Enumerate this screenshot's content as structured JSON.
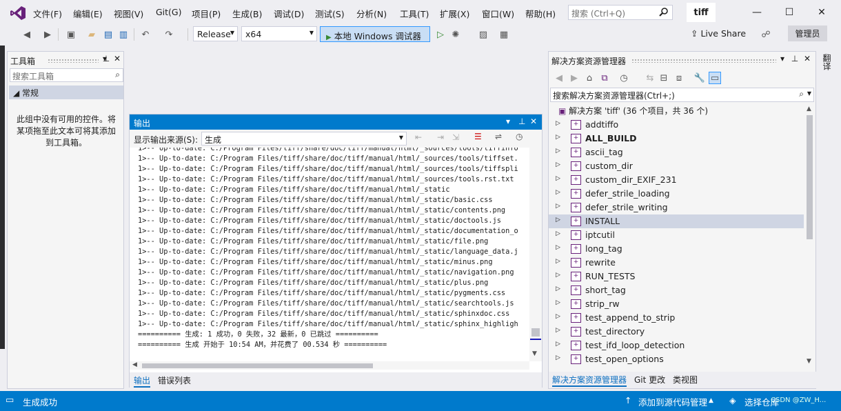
{
  "menu": [
    "文件(F)",
    "编辑(E)",
    "视图(V)",
    "Git(G)",
    "项目(P)",
    "生成(B)",
    "调试(D)",
    "测试(S)",
    "分析(N)",
    "工具(T)",
    "扩展(X)",
    "窗口(W)",
    "帮助(H)"
  ],
  "search": {
    "placeholder": "搜索 (Ctrl+Q)"
  },
  "project_title": "tiff",
  "toolbar": {
    "config": "Release",
    "platform": "x64",
    "run_label": "本地 Windows 调试器",
    "live_share": "Live Share",
    "admin": "管理员"
  },
  "toolbox": {
    "title": "工具箱",
    "search_placeholder": "搜索工具箱",
    "group": "常规",
    "empty_text": "此组中没有可用的控件。将某项拖至此文本可将其添加到工具箱。"
  },
  "output": {
    "title": "输出",
    "source_label": "显示输出来源(S):",
    "source_value": "生成",
    "lines": [
      "1>-- Up-to-date: C:/Program Files/tiff/share/doc/tiff/manual/html/_sources/tools/tiffinfo",
      "1>-- Up-to-date: C:/Program Files/tiff/share/doc/tiff/manual/html/_sources/tools/tiffset.",
      "1>-- Up-to-date: C:/Program Files/tiff/share/doc/tiff/manual/html/_sources/tools/tiffspli",
      "1>-- Up-to-date: C:/Program Files/tiff/share/doc/tiff/manual/html/_sources/tools.rst.txt",
      "1>-- Up-to-date: C:/Program Files/tiff/share/doc/tiff/manual/html/_static",
      "1>-- Up-to-date: C:/Program Files/tiff/share/doc/tiff/manual/html/_static/basic.css",
      "1>-- Up-to-date: C:/Program Files/tiff/share/doc/tiff/manual/html/_static/contents.png",
      "1>-- Up-to-date: C:/Program Files/tiff/share/doc/tiff/manual/html/_static/doctools.js",
      "1>-- Up-to-date: C:/Program Files/tiff/share/doc/tiff/manual/html/_static/documentation_o",
      "1>-- Up-to-date: C:/Program Files/tiff/share/doc/tiff/manual/html/_static/file.png",
      "1>-- Up-to-date: C:/Program Files/tiff/share/doc/tiff/manual/html/_static/language_data.j",
      "1>-- Up-to-date: C:/Program Files/tiff/share/doc/tiff/manual/html/_static/minus.png",
      "1>-- Up-to-date: C:/Program Files/tiff/share/doc/tiff/manual/html/_static/navigation.png",
      "1>-- Up-to-date: C:/Program Files/tiff/share/doc/tiff/manual/html/_static/plus.png",
      "1>-- Up-to-date: C:/Program Files/tiff/share/doc/tiff/manual/html/_static/pygments.css",
      "1>-- Up-to-date: C:/Program Files/tiff/share/doc/tiff/manual/html/_static/searchtools.js",
      "1>-- Up-to-date: C:/Program Files/tiff/share/doc/tiff/manual/html/_static/sphinxdoc.css",
      "1>-- Up-to-date: C:/Program Files/tiff/share/doc/tiff/manual/html/_static/sphinx_highligh",
      "========== 生成: 1 成功，0 失败，32 最新，0 已跳过 ==========",
      "========== 生成 开始于 10:54 AM，并花费了 00.534 秒 =========="
    ],
    "tabs": [
      "输出",
      "错误列表"
    ]
  },
  "solution": {
    "title": "解决方案资源管理器",
    "search_placeholder": "搜索解决方案资源管理器(Ctrl+;)",
    "root": "解决方案 'tiff' (36 个项目，共 36 个)",
    "items": [
      "addtiffo",
      "ALL_BUILD",
      "ascii_tag",
      "custom_dir",
      "custom_dir_EXIF_231",
      "defer_strile_loading",
      "defer_strile_writing",
      "INSTALL",
      "iptcutil",
      "long_tag",
      "rewrite",
      "RUN_TESTS",
      "short_tag",
      "strip_rw",
      "test_append_to_strip",
      "test_directory",
      "test_ifd_loop_detection",
      "test_open_options"
    ],
    "bold_item": "ALL_BUILD",
    "selected_item": "INSTALL",
    "tabs": [
      "解决方案资源管理器",
      "Git 更改",
      "类视图"
    ]
  },
  "right_strip": "翻译",
  "status": {
    "left": "生成成功",
    "add_source": "添加到源代码管理",
    "select_repo": "选择仓库",
    "watermark": "CSDN @ZW_H..."
  },
  "colors": {
    "accent": "#007acc",
    "vs_purple": "#68217a"
  }
}
